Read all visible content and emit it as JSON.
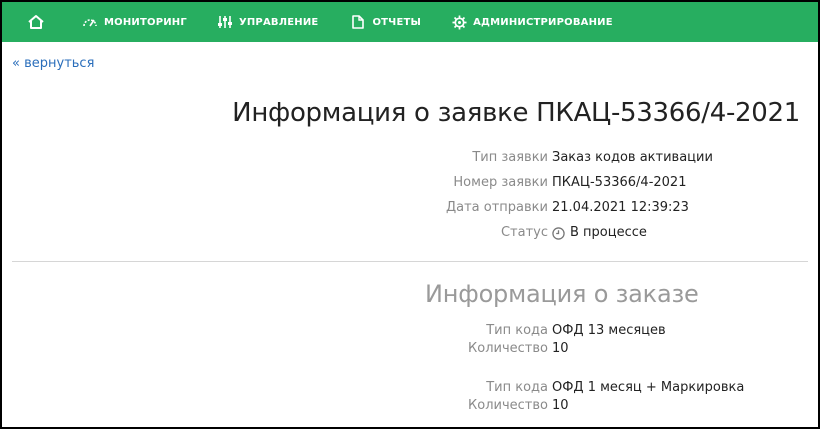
{
  "colors": {
    "navbar": "#27ae60",
    "link": "#2a6ebb",
    "label": "#8a8a8a"
  },
  "nav": {
    "home_icon": "home-icon",
    "items": [
      {
        "label": "МОНИТОРИНГ",
        "icon": "gauge-icon"
      },
      {
        "label": "УПРАВЛЕНИЕ",
        "icon": "sliders-icon"
      },
      {
        "label": "ОТЧЕТЫ",
        "icon": "document-icon"
      },
      {
        "label": "АДМИНИСТРИРОВАНИЕ",
        "icon": "gear-icon"
      }
    ]
  },
  "back_link": "« вернуться",
  "page_title": "Информация о заявке ПКАЦ-53366/4-2021",
  "request": {
    "type_label": "Тип заявки",
    "type_value": "Заказ кодов активации",
    "number_label": "Номер заявки",
    "number_value": "ПКАЦ-53366/4-2021",
    "date_label": "Дата отправки",
    "date_value": "21.04.2021 12:39:23",
    "status_label": "Статус",
    "status_value": "В процессе",
    "status_icon": "clock-icon"
  },
  "order": {
    "title": "Информация о заказе",
    "items": [
      {
        "code_label": "Тип кода",
        "code_value": "ОФД 13 месяцев",
        "qty_label": "Количество",
        "qty_value": "10"
      },
      {
        "code_label": "Тип кода",
        "code_value": "ОФД 1 месяц + Маркировка",
        "qty_label": "Количество",
        "qty_value": "10"
      }
    ]
  }
}
